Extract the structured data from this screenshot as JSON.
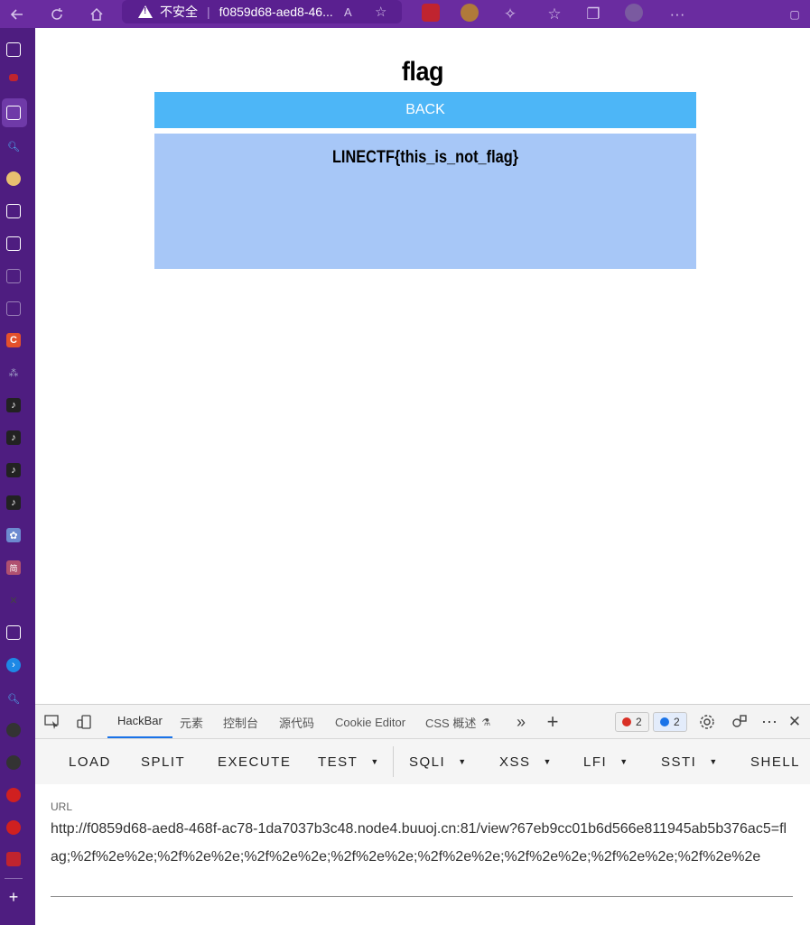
{
  "browser": {
    "security_label": "不安全",
    "tab_title": "f0859d68-aed8-46...",
    "read_aloud": "A",
    "more": "···"
  },
  "page": {
    "title": "flag",
    "back_label": "BACK",
    "flag_text": "LINECTF{this_is_not_flag}"
  },
  "devtools": {
    "tabs": [
      "HackBar",
      "元素",
      "控制台",
      "源代码",
      "Cookie Editor",
      "CSS 概述"
    ],
    "error_count": "2",
    "message_count": "2",
    "more_tabs": "»",
    "add_tab": "+",
    "more": "⋯",
    "close": "✕"
  },
  "hackbar": {
    "buttons": [
      "LOAD",
      "SPLIT",
      "EXECUTE",
      "TEST",
      "SQLI",
      "XSS",
      "LFI",
      "SSTI",
      "SHELL"
    ],
    "url_label": "URL",
    "url_value": "http://f0859d68-aed8-468f-ac78-1da7037b3c48.node4.buuoj.cn:81/view?67eb9cc01b6d566e811945ab5b376ac5=flag;%2f%2e%2e;%2f%2e%2e;%2f%2e%2e;%2f%2e%2e;%2f%2e%2e;%2f%2e%2e;%2f%2e%2e;%2f%2e%2e"
  },
  "sidebar": {
    "add": "+"
  },
  "colors": {
    "top_bar": "#6a2ca0",
    "sidebar": "#4e1d80",
    "back_button": "#4db6f7",
    "flag_box": "#a7c7f7"
  }
}
